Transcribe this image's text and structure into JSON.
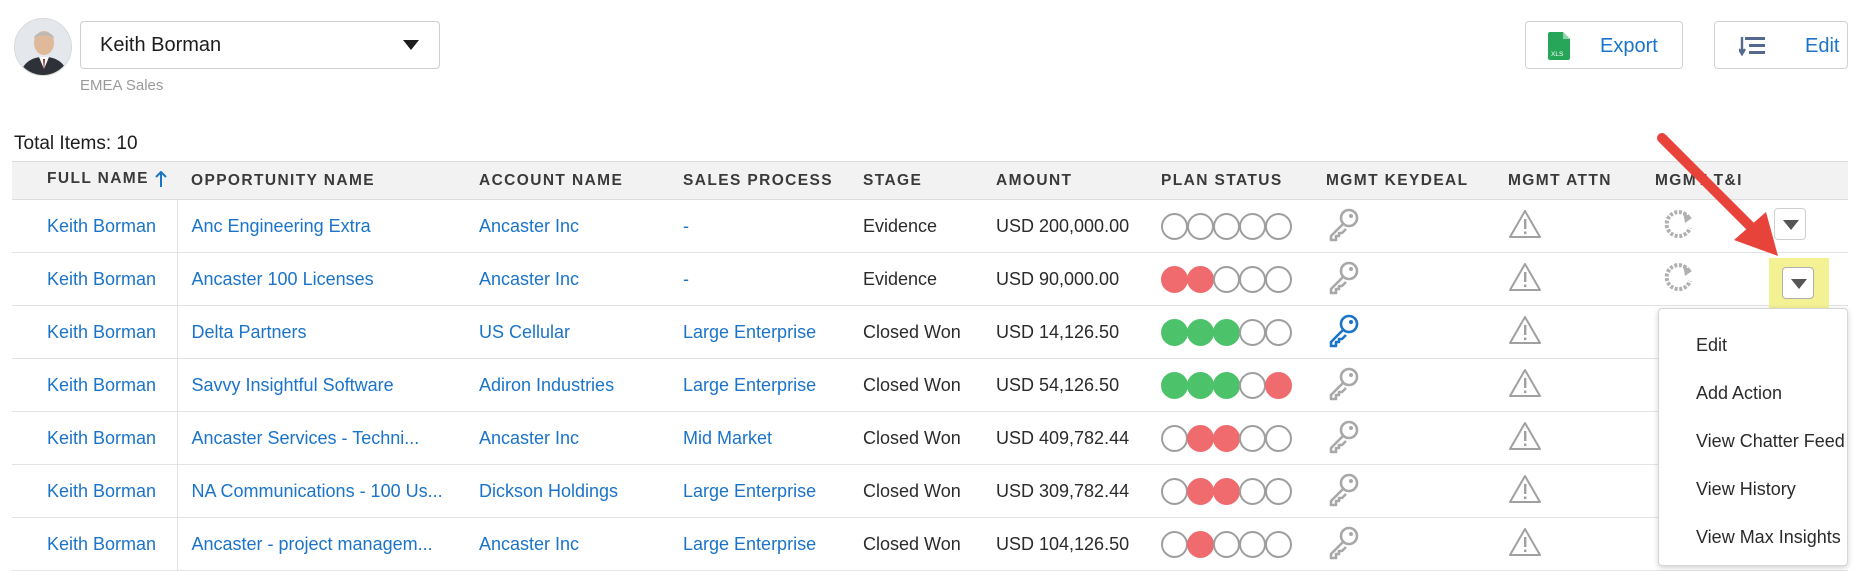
{
  "user": {
    "name": "Keith Borman",
    "region": "EMEA Sales"
  },
  "toolbar": {
    "export_label": "Export",
    "edit_label": "Edit",
    "export_icon_text": "XLS"
  },
  "total_items": "Total Items: 10",
  "columns": [
    "FULL NAME",
    "OPPORTUNITY NAME",
    "ACCOUNT NAME",
    "SALES PROCESS",
    "STAGE",
    "AMOUNT",
    "PLAN STATUS",
    "MGMT KEYDEAL",
    "MGMT ATTN",
    "MGMT T&I"
  ],
  "rows": [
    {
      "full_name": "Keith Borman",
      "opportunity": "Anc Engineering Extra",
      "account": "Ancaster Inc",
      "sales_process": "-",
      "stage": "Evidence",
      "amount": "USD 200,000.00",
      "plan_status": [
        "empty",
        "empty",
        "empty",
        "empty",
        "empty"
      ],
      "keydeal_active": false
    },
    {
      "full_name": "Keith Borman",
      "opportunity": "Ancaster 100 Licenses",
      "account": "Ancaster Inc",
      "sales_process": "-",
      "stage": "Evidence",
      "amount": "USD 90,000.00",
      "plan_status": [
        "red",
        "red",
        "empty",
        "empty",
        "empty"
      ],
      "keydeal_active": false
    },
    {
      "full_name": "Keith Borman",
      "opportunity": "Delta Partners",
      "account": "US Cellular",
      "sales_process": "Large Enterprise",
      "stage": "Closed Won",
      "amount": "USD 14,126.50",
      "plan_status": [
        "green",
        "green",
        "green",
        "empty",
        "empty"
      ],
      "keydeal_active": true
    },
    {
      "full_name": "Keith Borman",
      "opportunity": "Savvy Insightful Software",
      "account": "Adiron Industries",
      "sales_process": "Large Enterprise",
      "stage": "Closed Won",
      "amount": "USD 54,126.50",
      "plan_status": [
        "green",
        "green",
        "green",
        "empty",
        "red"
      ],
      "keydeal_active": false
    },
    {
      "full_name": "Keith Borman",
      "opportunity": "Ancaster Services - Techni...",
      "account": "Ancaster Inc",
      "sales_process": "Mid Market",
      "stage": "Closed Won",
      "amount": "USD 409,782.44",
      "plan_status": [
        "empty",
        "red",
        "red",
        "empty",
        "empty"
      ],
      "keydeal_active": false
    },
    {
      "full_name": "Keith Borman",
      "opportunity": "NA Communications - 100 Us...",
      "account": "Dickson Holdings",
      "sales_process": "Large Enterprise",
      "stage": "Closed Won",
      "amount": "USD 309,782.44",
      "plan_status": [
        "empty",
        "red",
        "red",
        "empty",
        "empty"
      ],
      "keydeal_active": false
    },
    {
      "full_name": "Keith Borman",
      "opportunity": "Ancaster - project managem...",
      "account": "Ancaster Inc",
      "sales_process": "Large Enterprise",
      "stage": "Closed Won",
      "amount": "USD 104,126.50",
      "plan_status": [
        "empty",
        "red",
        "empty",
        "empty",
        "empty"
      ],
      "keydeal_active": false
    }
  ],
  "row_menu": [
    "Edit",
    "Add Action",
    "View Chatter Feed",
    "View History",
    "View Max Insights"
  ],
  "colors": {
    "link": "#1b74c9",
    "red": "#ef6b6e",
    "green": "#4cc26a",
    "highlight": "#f3f194",
    "annotation": "#e8433a"
  }
}
